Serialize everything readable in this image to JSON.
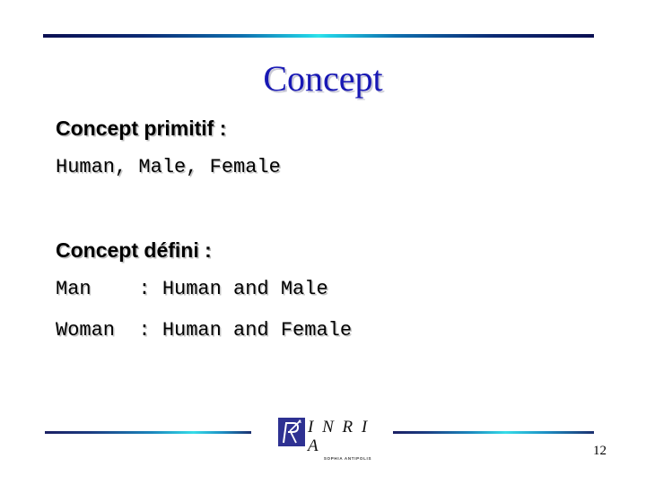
{
  "slide": {
    "title": "Concept",
    "sections": [
      {
        "heading": "Concept primitif :",
        "lines": [
          "Human, Male, Female"
        ]
      },
      {
        "heading": "Concept défini :",
        "lines": [
          "Man    : Human and Male",
          "Woman  : Human and Female"
        ]
      }
    ]
  },
  "footer": {
    "logo_name": "I N R I A",
    "logo_subtitle": "SOPHIA ANTIPOLIS",
    "logo_mark_icon": "inria-r-logo-icon",
    "page_number": "12"
  },
  "colors": {
    "title_blue": "#1818b4",
    "rule_navy": "#0b0f52",
    "rule_cyan": "#2fe3ea",
    "logo_navy": "#2e3192",
    "background": "#ffffff",
    "text": "#000000",
    "shadow_gray": "#bdbdbd"
  }
}
